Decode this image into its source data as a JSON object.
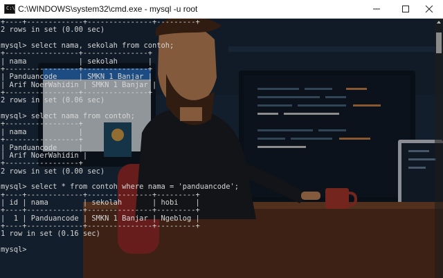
{
  "window": {
    "title": "C:\\WINDOWS\\system32\\cmd.exe - mysql  -u root",
    "icon_text": "C:\\"
  },
  "console": {
    "lines": [
      "+----+-------------+---------------+---------+",
      "2 rows in set (0.00 sec)",
      "",
      "mysql> select nama, sekolah from contoh;",
      "+-----------------+---------------+",
      "| nama            | sekolah       |",
      "+-----------------+---------------+",
      "| Panduancode     | SMKN 1 Banjar |",
      "| Arif NoerWahidin | SMKN 1 Banjar |",
      "+-----------------+---------------+",
      "2 rows in set (0.06 sec)",
      "",
      "mysql> select nama from contoh;",
      "+-----------------+",
      "| nama            |",
      "+-----------------+",
      "| Panduancode     |",
      "| Arif NoerWahidin |",
      "+-----------------+",
      "2 rows in set (0.00 sec)",
      "",
      "mysql> select * from contoh where nama = 'panduancode';",
      "+----+-------------+---------------+---------+",
      "| id | nama        | sekolah       | hobi    |",
      "+----+-------------+---------------+---------+",
      "|  1 | Panduancode | SMKN 1 Banjar | Ngeblog |",
      "+----+-------------+---------------+---------+",
      "1 row in set (0.16 sec)",
      "",
      "mysql>"
    ]
  },
  "colors": {
    "background": "#1b2c3f",
    "text": "#d6d6d6"
  },
  "icons": [
    "minimize-icon",
    "maximize-icon",
    "close-icon"
  ]
}
